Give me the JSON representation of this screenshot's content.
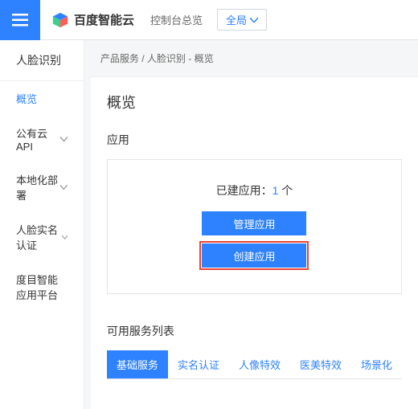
{
  "header": {
    "brand": "百度智能云",
    "console_label": "控制台总览",
    "global_select": "全局"
  },
  "sidebar": {
    "title": "人脸识别",
    "items": [
      {
        "label": "概览",
        "active": true,
        "expandable": false
      },
      {
        "label": "公有云API",
        "active": false,
        "expandable": true
      },
      {
        "label": "本地化部署",
        "active": false,
        "expandable": true
      },
      {
        "label": "人脸实名认证",
        "active": false,
        "expandable": true
      },
      {
        "label": "度目智能应用平台",
        "active": false,
        "expandable": false
      }
    ]
  },
  "breadcrumb": "产品服务 / 人脸识别 - 概览",
  "main": {
    "title": "概览",
    "app_section": {
      "label": "应用",
      "count_prefix": "已建应用：",
      "count_value": "1",
      "count_suffix": " 个",
      "manage_btn": "管理应用",
      "create_btn": "创建应用"
    },
    "service_section": {
      "label": "可用服务列表",
      "tabs": [
        "基础服务",
        "实名认证",
        "人像特效",
        "医美特效",
        "场景化"
      ]
    }
  }
}
